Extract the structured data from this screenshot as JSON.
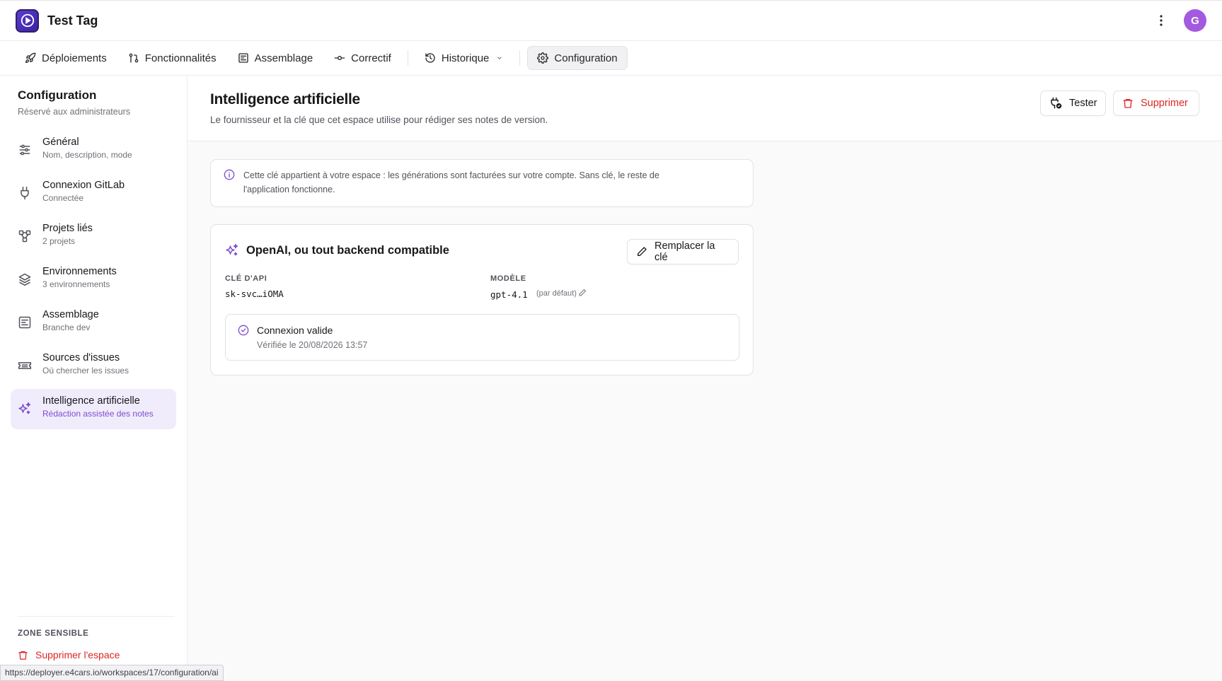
{
  "app": {
    "title": "Test Tag",
    "logo_icon": "play-logo-icon",
    "avatar_initial": "G"
  },
  "nav": {
    "tabs": [
      {
        "label": "Déploiements",
        "icon": "rocket-icon"
      },
      {
        "label": "Fonctionnalités",
        "icon": "git-pull-request-icon"
      },
      {
        "label": "Assemblage",
        "icon": "frame-icon"
      },
      {
        "label": "Correctif",
        "icon": "git-commit-icon"
      },
      {
        "label": "Historique",
        "icon": "history-icon"
      },
      {
        "label": "Configuration",
        "icon": "gear-icon",
        "active": true
      }
    ]
  },
  "sidebar": {
    "title": "Configuration",
    "subtitle": "Réservé aux administrateurs",
    "items": [
      {
        "label": "Général",
        "desc": "Nom, description, mode",
        "icon": "sliders-icon"
      },
      {
        "label": "Connexion GitLab",
        "desc": "Connectée",
        "icon": "plug-icon"
      },
      {
        "label": "Projets liés",
        "desc": "2 projets",
        "icon": "network-icon"
      },
      {
        "label": "Environnements",
        "desc": "3 environnements",
        "icon": "layers-icon"
      },
      {
        "label": "Assemblage",
        "desc": "Branche dev",
        "icon": "frame-icon"
      },
      {
        "label": "Sources d'issues",
        "desc": "Où chercher les issues",
        "icon": "ticket-icon"
      },
      {
        "label": "Intelligence artificielle",
        "desc": "Rédaction assistée des notes",
        "icon": "sparkles-icon",
        "active": true
      }
    ],
    "danger_zone_label": "ZONE SENSIBLE",
    "delete_space_label": "Supprimer l'espace"
  },
  "status_url": "https://deployer.e4cars.io/workspaces/17/configuration/ai",
  "main": {
    "title": "Intelligence artificielle",
    "subtitle": "Le fournisseur et la clé que cet espace utilise pour rédiger ses notes de version.",
    "test_label": "Tester",
    "delete_label": "Supprimer",
    "info_text": "Cette clé appartient à votre espace : les générations sont facturées sur votre compte. Sans clé, le reste de l'application fonctionne.",
    "provider": {
      "title": "OpenAI, ou tout backend compatible",
      "replace_label": "Remplacer la clé",
      "api_key_label": "CLÉ D'API",
      "api_key_value": "sk-svc…iOMA",
      "model_label": "MODÈLE",
      "model_value": "gpt-4.1",
      "model_default_tag": "(par défaut)",
      "connection_title": "Connexion valide",
      "connection_sub": "Vérifiée le 20/08/2026 13:57"
    }
  },
  "colors": {
    "accent": "#7c4dcc",
    "danger": "#dc2626",
    "avatar": "#a35ae0",
    "logo": "#4a2fb8"
  }
}
